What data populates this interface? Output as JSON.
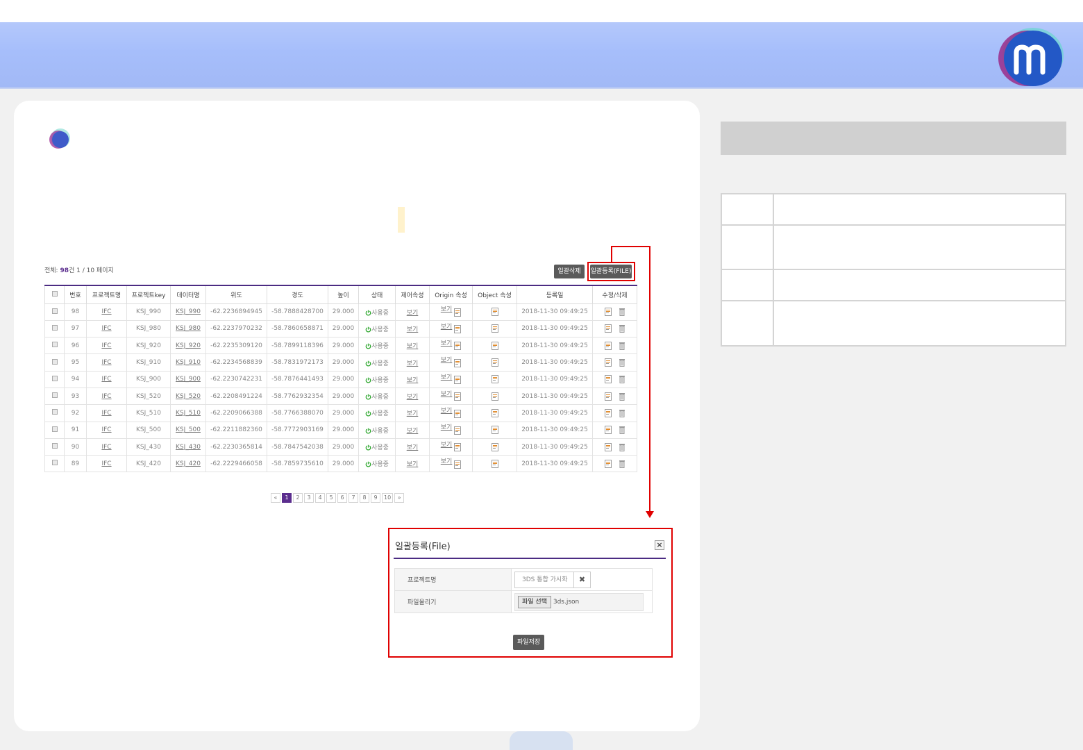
{
  "summary": {
    "prefix": "전체: ",
    "count": "98",
    "suffix": "건 1 / 10 페이지"
  },
  "buttons": {
    "bulk_delete": "일괄삭제",
    "bulk_register": "일괄등록(FILE)"
  },
  "table": {
    "headers": [
      "번호",
      "프로젝트명",
      "프로젝트key",
      "데이터명",
      "위도",
      "경도",
      "높이",
      "상태",
      "제어속성",
      "Origin 속성",
      "Object 속성",
      "등록일",
      "수정/삭제"
    ],
    "rows": [
      {
        "no": "98",
        "project": "IFC",
        "key": "KSJ_990",
        "data": "KSJ_990",
        "lat": "-62.2236894945",
        "lon": "-58.7888428700",
        "height": "29.000",
        "status": "사용중",
        "control": "보기",
        "origin": "보기",
        "date": "2018-11-30 09:49:25"
      },
      {
        "no": "97",
        "project": "IFC",
        "key": "KSJ_980",
        "data": "KSJ_980",
        "lat": "-62.2237970232",
        "lon": "-58.7860658871",
        "height": "29.000",
        "status": "사용중",
        "control": "보기",
        "origin": "보기",
        "date": "2018-11-30 09:49:25"
      },
      {
        "no": "96",
        "project": "IFC",
        "key": "KSJ_920",
        "data": "KSJ_920",
        "lat": "-62.2235309120",
        "lon": "-58.7899118396",
        "height": "29.000",
        "status": "사용중",
        "control": "보기",
        "origin": "보기",
        "date": "2018-11-30 09:49:25"
      },
      {
        "no": "95",
        "project": "IFC",
        "key": "KSJ_910",
        "data": "KSJ_910",
        "lat": "-62.2234568839",
        "lon": "-58.7831972173",
        "height": "29.000",
        "status": "사용중",
        "control": "보기",
        "origin": "보기",
        "date": "2018-11-30 09:49:25"
      },
      {
        "no": "94",
        "project": "IFC",
        "key": "KSJ_900",
        "data": "KSJ_900",
        "lat": "-62.2230742231",
        "lon": "-58.7876441493",
        "height": "29.000",
        "status": "사용중",
        "control": "보기",
        "origin": "보기",
        "date": "2018-11-30 09:49:25"
      },
      {
        "no": "93",
        "project": "IFC",
        "key": "KSJ_520",
        "data": "KSJ_520",
        "lat": "-62.2208491224",
        "lon": "-58.7762932354",
        "height": "29.000",
        "status": "사용중",
        "control": "보기",
        "origin": "보기",
        "date": "2018-11-30 09:49:25"
      },
      {
        "no": "92",
        "project": "IFC",
        "key": "KSJ_510",
        "data": "KSJ_510",
        "lat": "-62.2209066388",
        "lon": "-58.7766388070",
        "height": "29.000",
        "status": "사용중",
        "control": "보기",
        "origin": "보기",
        "date": "2018-11-30 09:49:25"
      },
      {
        "no": "91",
        "project": "IFC",
        "key": "KSJ_500",
        "data": "KSJ_500",
        "lat": "-62.2211882360",
        "lon": "-58.7772903169",
        "height": "29.000",
        "status": "사용중",
        "control": "보기",
        "origin": "보기",
        "date": "2018-11-30 09:49:25"
      },
      {
        "no": "90",
        "project": "IFC",
        "key": "KSJ_430",
        "data": "KSJ_430",
        "lat": "-62.2230365814",
        "lon": "-58.7847542038",
        "height": "29.000",
        "status": "사용중",
        "control": "보기",
        "origin": "보기",
        "date": "2018-11-30 09:49:25"
      },
      {
        "no": "89",
        "project": "IFC",
        "key": "KSJ_420",
        "data": "KSJ_420",
        "lat": "-62.2229466058",
        "lon": "-58.7859735610",
        "height": "29.000",
        "status": "사용중",
        "control": "보기",
        "origin": "보기",
        "date": "2018-11-30 09:49:25"
      }
    ]
  },
  "pagination": {
    "first": "«",
    "last": "»",
    "pages": [
      "1",
      "2",
      "3",
      "4",
      "5",
      "6",
      "7",
      "8",
      "9",
      "10"
    ],
    "current": "1"
  },
  "popup": {
    "title": "일괄등록(File)",
    "close": "×",
    "project_label": "프로젝트명",
    "project_value": "3DS 통합 가시화",
    "project_clear": "✖",
    "file_label": "파일올리기",
    "file_button": "파일 선택",
    "file_name": "3ds.json",
    "save": "파일저장"
  },
  "colors": {
    "accent": "#4b2b82",
    "highlight": "#e00000",
    "banner": "#a6befb",
    "status_on": "#2aa52a"
  },
  "icons": {
    "status": "power-icon",
    "attribute": "document-icon",
    "delete": "trash-icon",
    "logo": "m-logo"
  }
}
